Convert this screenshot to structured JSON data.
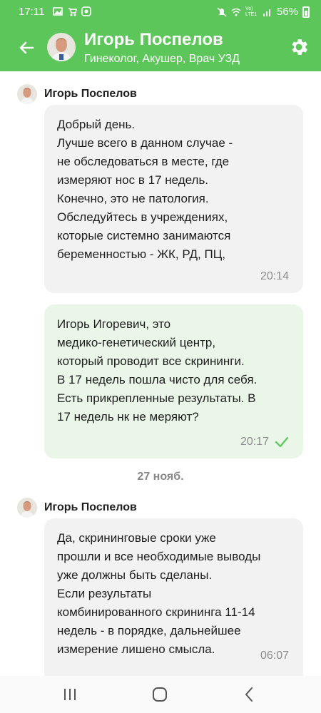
{
  "status_bar": {
    "time": "17:11",
    "battery": "56%",
    "network": "Vo) LTE1"
  },
  "header": {
    "title": "Игорь Поспелов",
    "subtitle": "Гинеколог, Акушер, Врач УЗД",
    "accent_color": "#5cc65a"
  },
  "messages": [
    {
      "sender": "Игорь Поспелов",
      "lines": [
        "Добрый день.",
        "Лучше всего в данном случае -",
        "не обследоваться в месте, где",
        "измеряют нос в 17 недель.",
        "Конечно, это не патология.",
        "Обследуйтесь в учреждениях,",
        "которые системно занимаются",
        "беременностью - ЖК, РД, ПЦ,"
      ],
      "time": "20:14"
    },
    {
      "lines": [
        "Игорь Игоревич, это",
        "медико-генетический центр,",
        "который проводит все скрининги.",
        "В 17 недель пошла чисто для себя.",
        "Есть прикрепленные результаты. В",
        "17 недель нк не меряют?"
      ],
      "time": "20:17"
    },
    {
      "sender": "Игорь Поспелов",
      "lines": [
        "Да, скрининговые сроки уже",
        "прошли и все необходимые выводы",
        "уже должны быть сделаны.",
        "Если результаты",
        "комбинированного скрининга 11-14",
        "недель - в порядке, дальнейшее",
        "измерение лишено смысла."
      ],
      "time": "06:07"
    }
  ],
  "date_separator": "27 нояб."
}
